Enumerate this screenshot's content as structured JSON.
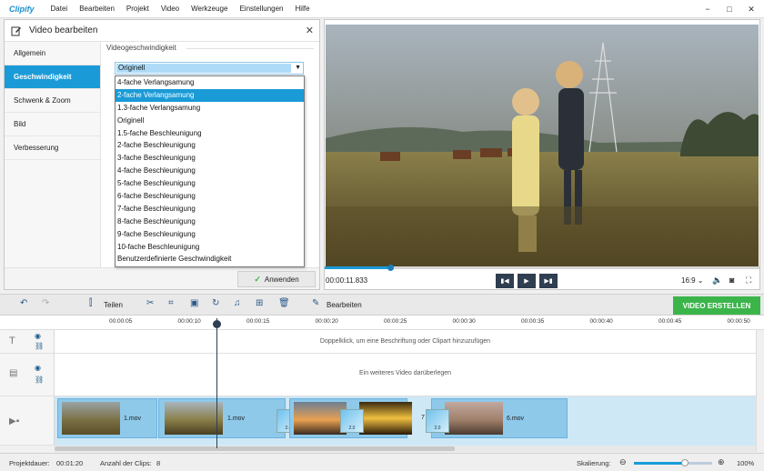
{
  "app": {
    "logo": "Clipify"
  },
  "menu": [
    "Datei",
    "Bearbeiten",
    "Projekt",
    "Video",
    "Werkzeuge",
    "Einstellungen",
    "Hilfe"
  ],
  "window_controls": [
    "−",
    "□",
    "✕"
  ],
  "dialog": {
    "title": "Video bearbeiten",
    "close": "✕",
    "sidebar": [
      "Allgemein",
      "Geschwindigkeit",
      "Schwenk & Zoom",
      "Bild",
      "Verbesserung"
    ],
    "active_index": 1,
    "section_label": "Videogeschwindigkeit",
    "selected_value": "Originell",
    "dropdown_options": [
      "4-fache Verlangsamung",
      "2-fache Verlangsamung",
      "1.3-fache Verlangsamung",
      "Originell",
      "1.5-fache Beschleunigung",
      "2-fache Beschleunigung",
      "3-fache Beschleunigung",
      "4-fache Beschleunigung",
      "5-fache Beschleunigung",
      "6-fache Beschleunigung",
      "7-fache Beschleunigung",
      "8-fache Beschleunigung",
      "9-fache Beschleunigung",
      "10-fache Beschleunigung",
      "Benutzerdefinierte Geschwindigkeit"
    ],
    "highlighted_index": 1,
    "apply_label": "Anwenden"
  },
  "preview": {
    "time": "00:00:11.833",
    "progress": 0.15,
    "aspect": "16:9 ⌄"
  },
  "toolbar": {
    "split_label": "Teilen",
    "edit_label": "Bearbeiten",
    "create_label": "VIDEO ERSTELLEN"
  },
  "ruler": {
    "ticks": [
      "00:00:05",
      "00:00:10",
      "00:00:15",
      "00:00:20",
      "00:00:25",
      "00:00:30",
      "00:00:35",
      "00:00:40",
      "00:00:45",
      "00:00:50"
    ]
  },
  "tracks": {
    "text_hint": "Doppelklick, um eine Beschriftung oder Clipart hinzuzufügen",
    "overlay_hint": "Ein weiteres Video darüberlegen",
    "clips": [
      "1.mov",
      "1.mov",
      "7",
      "6.mov"
    ],
    "transition_label": "2.0"
  },
  "status": {
    "duration_label": "Projektdauer:",
    "duration_value": "00:01:20",
    "clips_label": "Anzahl der Clips:",
    "clips_value": "8",
    "scale_label": "Skalierung:",
    "scale_value": "100%",
    "scale_level": 0.65
  },
  "colors": {
    "accent": "#1a9bd7",
    "create": "#3bb54a",
    "dark": "#2f3e50"
  }
}
